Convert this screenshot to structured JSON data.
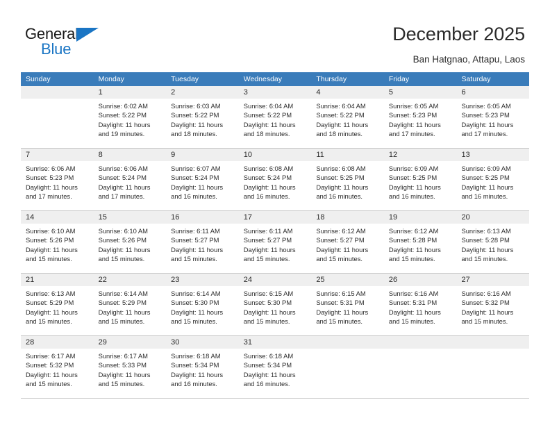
{
  "brand": {
    "name_part1": "General",
    "name_part2": "Blue",
    "accent_color": "#1a75c4",
    "logo_icon": "blue-triangle-icon"
  },
  "header": {
    "title": "December 2025",
    "subtitle": "Ban Hatgnao, Attapu, Laos"
  },
  "calendar": {
    "header_color": "#3a7cba",
    "weekdays": [
      "Sunday",
      "Monday",
      "Tuesday",
      "Wednesday",
      "Thursday",
      "Friday",
      "Saturday"
    ],
    "weeks": [
      [
        {
          "day": "",
          "sunrise": "",
          "sunset": "",
          "daylight_line1": "",
          "daylight_line2": "",
          "empty": true
        },
        {
          "day": "1",
          "sunrise": "Sunrise: 6:02 AM",
          "sunset": "Sunset: 5:22 PM",
          "daylight_line1": "Daylight: 11 hours",
          "daylight_line2": "and 19 minutes."
        },
        {
          "day": "2",
          "sunrise": "Sunrise: 6:03 AM",
          "sunset": "Sunset: 5:22 PM",
          "daylight_line1": "Daylight: 11 hours",
          "daylight_line2": "and 18 minutes."
        },
        {
          "day": "3",
          "sunrise": "Sunrise: 6:04 AM",
          "sunset": "Sunset: 5:22 PM",
          "daylight_line1": "Daylight: 11 hours",
          "daylight_line2": "and 18 minutes."
        },
        {
          "day": "4",
          "sunrise": "Sunrise: 6:04 AM",
          "sunset": "Sunset: 5:22 PM",
          "daylight_line1": "Daylight: 11 hours",
          "daylight_line2": "and 18 minutes."
        },
        {
          "day": "5",
          "sunrise": "Sunrise: 6:05 AM",
          "sunset": "Sunset: 5:23 PM",
          "daylight_line1": "Daylight: 11 hours",
          "daylight_line2": "and 17 minutes."
        },
        {
          "day": "6",
          "sunrise": "Sunrise: 6:05 AM",
          "sunset": "Sunset: 5:23 PM",
          "daylight_line1": "Daylight: 11 hours",
          "daylight_line2": "and 17 minutes."
        }
      ],
      [
        {
          "day": "7",
          "sunrise": "Sunrise: 6:06 AM",
          "sunset": "Sunset: 5:23 PM",
          "daylight_line1": "Daylight: 11 hours",
          "daylight_line2": "and 17 minutes."
        },
        {
          "day": "8",
          "sunrise": "Sunrise: 6:06 AM",
          "sunset": "Sunset: 5:24 PM",
          "daylight_line1": "Daylight: 11 hours",
          "daylight_line2": "and 17 minutes."
        },
        {
          "day": "9",
          "sunrise": "Sunrise: 6:07 AM",
          "sunset": "Sunset: 5:24 PM",
          "daylight_line1": "Daylight: 11 hours",
          "daylight_line2": "and 16 minutes."
        },
        {
          "day": "10",
          "sunrise": "Sunrise: 6:08 AM",
          "sunset": "Sunset: 5:24 PM",
          "daylight_line1": "Daylight: 11 hours",
          "daylight_line2": "and 16 minutes."
        },
        {
          "day": "11",
          "sunrise": "Sunrise: 6:08 AM",
          "sunset": "Sunset: 5:25 PM",
          "daylight_line1": "Daylight: 11 hours",
          "daylight_line2": "and 16 minutes."
        },
        {
          "day": "12",
          "sunrise": "Sunrise: 6:09 AM",
          "sunset": "Sunset: 5:25 PM",
          "daylight_line1": "Daylight: 11 hours",
          "daylight_line2": "and 16 minutes."
        },
        {
          "day": "13",
          "sunrise": "Sunrise: 6:09 AM",
          "sunset": "Sunset: 5:25 PM",
          "daylight_line1": "Daylight: 11 hours",
          "daylight_line2": "and 16 minutes."
        }
      ],
      [
        {
          "day": "14",
          "sunrise": "Sunrise: 6:10 AM",
          "sunset": "Sunset: 5:26 PM",
          "daylight_line1": "Daylight: 11 hours",
          "daylight_line2": "and 15 minutes."
        },
        {
          "day": "15",
          "sunrise": "Sunrise: 6:10 AM",
          "sunset": "Sunset: 5:26 PM",
          "daylight_line1": "Daylight: 11 hours",
          "daylight_line2": "and 15 minutes."
        },
        {
          "day": "16",
          "sunrise": "Sunrise: 6:11 AM",
          "sunset": "Sunset: 5:27 PM",
          "daylight_line1": "Daylight: 11 hours",
          "daylight_line2": "and 15 minutes."
        },
        {
          "day": "17",
          "sunrise": "Sunrise: 6:11 AM",
          "sunset": "Sunset: 5:27 PM",
          "daylight_line1": "Daylight: 11 hours",
          "daylight_line2": "and 15 minutes."
        },
        {
          "day": "18",
          "sunrise": "Sunrise: 6:12 AM",
          "sunset": "Sunset: 5:27 PM",
          "daylight_line1": "Daylight: 11 hours",
          "daylight_line2": "and 15 minutes."
        },
        {
          "day": "19",
          "sunrise": "Sunrise: 6:12 AM",
          "sunset": "Sunset: 5:28 PM",
          "daylight_line1": "Daylight: 11 hours",
          "daylight_line2": "and 15 minutes."
        },
        {
          "day": "20",
          "sunrise": "Sunrise: 6:13 AM",
          "sunset": "Sunset: 5:28 PM",
          "daylight_line1": "Daylight: 11 hours",
          "daylight_line2": "and 15 minutes."
        }
      ],
      [
        {
          "day": "21",
          "sunrise": "Sunrise: 6:13 AM",
          "sunset": "Sunset: 5:29 PM",
          "daylight_line1": "Daylight: 11 hours",
          "daylight_line2": "and 15 minutes."
        },
        {
          "day": "22",
          "sunrise": "Sunrise: 6:14 AM",
          "sunset": "Sunset: 5:29 PM",
          "daylight_line1": "Daylight: 11 hours",
          "daylight_line2": "and 15 minutes."
        },
        {
          "day": "23",
          "sunrise": "Sunrise: 6:14 AM",
          "sunset": "Sunset: 5:30 PM",
          "daylight_line1": "Daylight: 11 hours",
          "daylight_line2": "and 15 minutes."
        },
        {
          "day": "24",
          "sunrise": "Sunrise: 6:15 AM",
          "sunset": "Sunset: 5:30 PM",
          "daylight_line1": "Daylight: 11 hours",
          "daylight_line2": "and 15 minutes."
        },
        {
          "day": "25",
          "sunrise": "Sunrise: 6:15 AM",
          "sunset": "Sunset: 5:31 PM",
          "daylight_line1": "Daylight: 11 hours",
          "daylight_line2": "and 15 minutes."
        },
        {
          "day": "26",
          "sunrise": "Sunrise: 6:16 AM",
          "sunset": "Sunset: 5:31 PM",
          "daylight_line1": "Daylight: 11 hours",
          "daylight_line2": "and 15 minutes."
        },
        {
          "day": "27",
          "sunrise": "Sunrise: 6:16 AM",
          "sunset": "Sunset: 5:32 PM",
          "daylight_line1": "Daylight: 11 hours",
          "daylight_line2": "and 15 minutes."
        }
      ],
      [
        {
          "day": "28",
          "sunrise": "Sunrise: 6:17 AM",
          "sunset": "Sunset: 5:32 PM",
          "daylight_line1": "Daylight: 11 hours",
          "daylight_line2": "and 15 minutes."
        },
        {
          "day": "29",
          "sunrise": "Sunrise: 6:17 AM",
          "sunset": "Sunset: 5:33 PM",
          "daylight_line1": "Daylight: 11 hours",
          "daylight_line2": "and 15 minutes."
        },
        {
          "day": "30",
          "sunrise": "Sunrise: 6:18 AM",
          "sunset": "Sunset: 5:34 PM",
          "daylight_line1": "Daylight: 11 hours",
          "daylight_line2": "and 16 minutes."
        },
        {
          "day": "31",
          "sunrise": "Sunrise: 6:18 AM",
          "sunset": "Sunset: 5:34 PM",
          "daylight_line1": "Daylight: 11 hours",
          "daylight_line2": "and 16 minutes."
        },
        {
          "day": "",
          "sunrise": "",
          "sunset": "",
          "daylight_line1": "",
          "daylight_line2": "",
          "empty": true
        },
        {
          "day": "",
          "sunrise": "",
          "sunset": "",
          "daylight_line1": "",
          "daylight_line2": "",
          "empty": true
        },
        {
          "day": "",
          "sunrise": "",
          "sunset": "",
          "daylight_line1": "",
          "daylight_line2": "",
          "empty": true
        }
      ]
    ]
  }
}
